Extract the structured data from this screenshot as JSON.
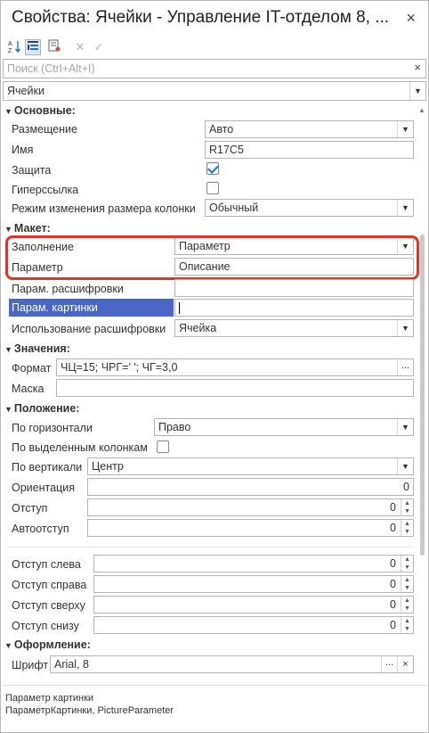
{
  "window": {
    "title": "Свойства: Ячейки - Управление IT-отделом 8, ...",
    "close_symbol": "×"
  },
  "toolbar": {
    "sort_icon": "sort-az-icon",
    "categories_icon": "categories-icon",
    "filter_icon": "filter-icon",
    "cancel_icon": "cancel-icon",
    "apply_icon": "apply-icon"
  },
  "search": {
    "placeholder": "Поиск (Ctrl+Alt+I)",
    "clear_symbol": "×"
  },
  "object_selector": {
    "value": "Ячейки"
  },
  "sections": {
    "main": "Основные:",
    "layout": "Макет:",
    "values": "Значения:",
    "position": "Положение:",
    "design": "Оформление:"
  },
  "main": {
    "placement_label": "Размещение",
    "placement_value": "Авто",
    "name_label": "Имя",
    "name_value": "R17C5",
    "protection_label": "Защита",
    "protection_checked": true,
    "hyperlink_label": "Гиперссылка",
    "hyperlink_checked": false,
    "resize_label": "Режим изменения размера колонки",
    "resize_value": "Обычный"
  },
  "layout": {
    "fill_label": "Заполнение",
    "fill_value": "Параметр",
    "param_label": "Параметр",
    "param_value": "Описание",
    "decode_param_label": "Парам. расшифровки",
    "decode_param_value": "",
    "picture_param_label": "Парам. картинки",
    "picture_param_value": "",
    "decode_use_label": "Использование расшифровки",
    "decode_use_value": "Ячейка"
  },
  "values": {
    "format_label": "Формат",
    "format_value": "ЧЦ=15; ЧРГ=' '; ЧГ=3,0",
    "mask_label": "Маска",
    "mask_value": ""
  },
  "position": {
    "horizontal_label": "По горизонтали",
    "horizontal_value": "Право",
    "selected_columns_label": "По выделенным колонкам",
    "selected_columns_checked": false,
    "vertical_label": "По вертикали",
    "vertical_value": "Центр",
    "orientation_label": "Ориентация",
    "orientation_value": "0",
    "indent_label": "Отступ",
    "indent_value": "0",
    "autoindent_label": "Автоотступ",
    "autoindent_value": "0",
    "indent_left_label": "Отступ слева",
    "indent_left_value": "0",
    "indent_right_label": "Отступ справа",
    "indent_right_value": "0",
    "indent_top_label": "Отступ сверху",
    "indent_top_value": "0",
    "indent_bottom_label": "Отступ снизу",
    "indent_bottom_value": "0"
  },
  "design": {
    "font_label": "Шрифт",
    "font_value": "Arial, 8"
  },
  "footer": {
    "line1": "Параметр картинки",
    "line2": "ПараметрКартинки, PictureParameter"
  },
  "colors": {
    "selection": "#4a67c6",
    "highlight_border": "#d6382d",
    "checkmark": "#1e73d6"
  }
}
